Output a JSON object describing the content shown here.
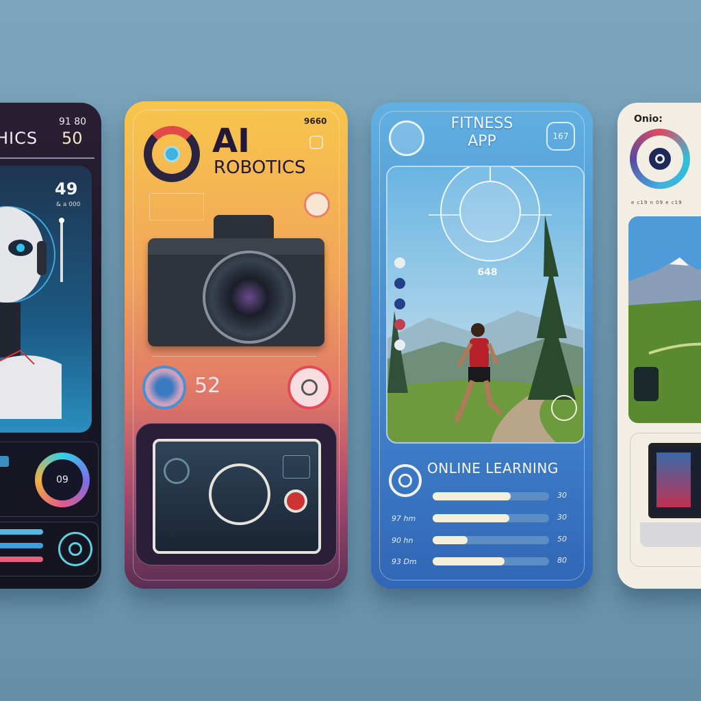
{
  "cards": [
    {
      "title": "HICS",
      "top_readout": "91 80",
      "main_value": "50",
      "stat_value": "49",
      "stat_caption": "& a 000",
      "gauge_value": "09",
      "bars": [
        0.55,
        0.5,
        0.5
      ],
      "colors": {
        "bg": "#161624",
        "accent": "#2fb8e0"
      }
    },
    {
      "title": "AI",
      "subtitle": "ROBOTICS",
      "top_readout": "9660",
      "counter_value": "52",
      "colors": {
        "top": "#f7c64b",
        "middle": "#e07868",
        "bottom": "#5b2e55"
      }
    },
    {
      "title": "FITNESS",
      "subtitle": "APP",
      "badge": "167",
      "center_readout": "648",
      "section_title": "ONLINE LEARNING",
      "progress_rows": [
        {
          "label": "",
          "value": "30",
          "progress": 0.67
        },
        {
          "label": "97 hm",
          "value": "30",
          "progress": 0.66
        },
        {
          "label": "90 hn",
          "value": "50",
          "progress": 0.3
        },
        {
          "label": "93 Dm",
          "value": "80",
          "progress": 0.62
        }
      ],
      "colors": {
        "top": "#62b0e2",
        "bottom": "#3266b5"
      }
    },
    {
      "title": "Onio:",
      "caption": "e c19 n 09 e c19",
      "colors": {
        "bg": "#f3eee4"
      }
    }
  ]
}
